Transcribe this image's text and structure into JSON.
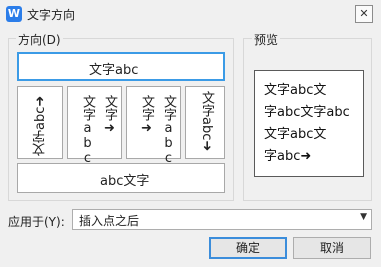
{
  "window": {
    "title": "文字方向",
    "icon_letter": "W",
    "close_glyph": "✕"
  },
  "direction_group": {
    "label": "方向(D)",
    "options": [
      {
        "name": "horizontal",
        "text": "文字abc"
      },
      {
        "name": "vertical-rotate-left",
        "text": "文字abc➜"
      },
      {
        "name": "vertical-stacked-rtl",
        "col1": "文字abc",
        "col2": "文字➜"
      },
      {
        "name": "vertical-stacked-ltr",
        "col1": "文字➜",
        "col2": "文字abc"
      },
      {
        "name": "vertical-rotate-right",
        "text": "文字abc➜"
      },
      {
        "name": "horizontal-flipped",
        "text": "abc文字"
      }
    ]
  },
  "preview_group": {
    "label": "预览",
    "lines": [
      "文字abc文",
      "字abc文字abc",
      "文字abc文",
      "字abc➜"
    ]
  },
  "apply_to": {
    "label": "应用于(Y):",
    "value": "插入点之后",
    "arrow": "▼"
  },
  "buttons": {
    "ok": "确定",
    "cancel": "取消"
  }
}
